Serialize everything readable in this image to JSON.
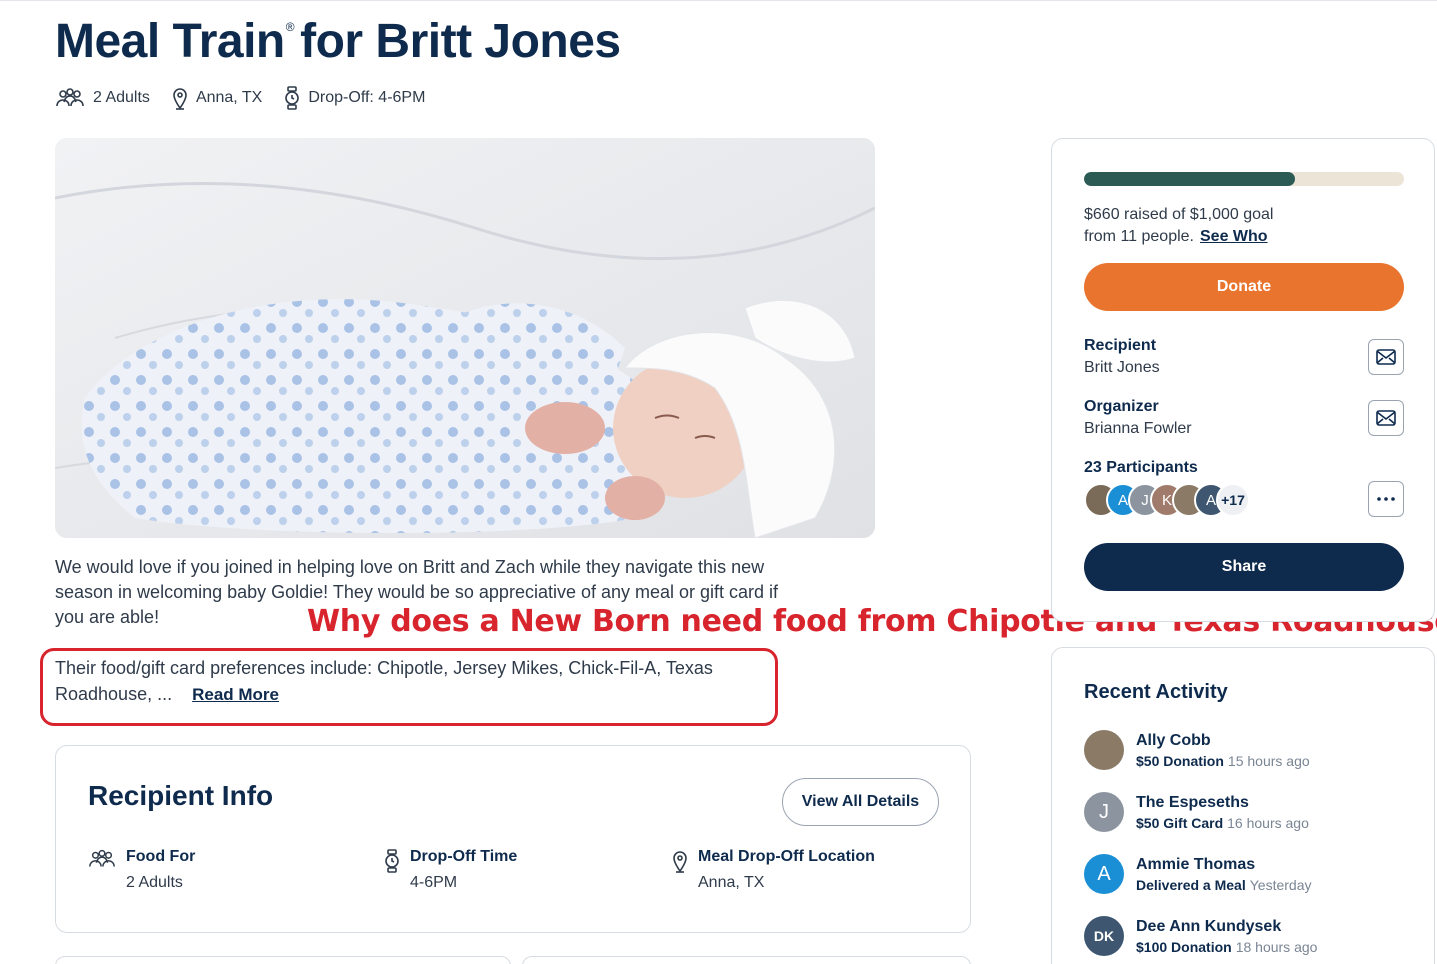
{
  "header": {
    "title": "Meal Train",
    "trademark": "®",
    "title_suffix": "for Britt Jones",
    "meta": [
      {
        "icon": "people-icon",
        "text": "2 Adults"
      },
      {
        "icon": "location-pin-icon",
        "text": "Anna, TX"
      },
      {
        "icon": "watch-icon",
        "text": "Drop-Off: 4-6PM"
      }
    ]
  },
  "photo": {
    "alt": "newborn-baby-photo"
  },
  "description": {
    "text": "We would love if you joined in helping love on Britt and Zach while they navigate this new season in welcoming baby Goldie! They would be so appreciative of any meal or gift card if you are able!",
    "preferences": "Their food/gift card preferences include: Chipotle, Jersey Mikes, Chick-Fil-A, Texas Roadhouse, ...",
    "read_more": "Read More"
  },
  "annotation": "Why does a New Born need food from Chipotle and Texas Roadhouse?",
  "recipient_info": {
    "title": "Recipient Info",
    "view_all": "View All Details",
    "food_for_label": "Food For",
    "food_for_value": "2 Adults",
    "dropoff_time_label": "Drop-Off Time",
    "dropoff_time_value": "4-6PM",
    "location_label": "Meal Drop-Off Location",
    "location_value": "Anna, TX"
  },
  "fundraiser": {
    "progress": 0.66,
    "raised_text": "$660 raised of $1,000 goal",
    "from_text": "from 11 people.",
    "see_who": "See Who",
    "donate": "Donate",
    "recipient_label": "Recipient",
    "recipient_name": "Britt Jones",
    "organizer_label": "Organizer",
    "organizer_name": "Brianna Fowler",
    "participants_label": "23 Participants",
    "participants_more": "+17",
    "participant_initials": [
      "A",
      "J",
      "K",
      "A"
    ],
    "share": "Share",
    "colors": {
      "progress_fill": "#2c5a55",
      "progress_track": "#ece4d6",
      "donate": "#e8742d",
      "share": "#0e2a4d"
    }
  },
  "activity": {
    "title": "Recent Activity",
    "items": [
      {
        "name": "Ally Cobb",
        "action": "$50 Donation",
        "time": "15 hours ago",
        "initials": "",
        "color": "#8a7a66"
      },
      {
        "name": "The Espeseths",
        "action": "$50 Gift Card",
        "time": "16 hours ago",
        "initials": "J",
        "color": "#8c959f"
      },
      {
        "name": "Ammie Thomas",
        "action": "Delivered a Meal",
        "time": "Yesterday",
        "initials": "A",
        "color": "#1a8fd6"
      },
      {
        "name": "Dee Ann Kundysek",
        "action": "$100 Donation",
        "time": "18 hours ago",
        "initials": "DK",
        "color": "#3f5670"
      }
    ]
  },
  "annotation_color": "#d8242c"
}
